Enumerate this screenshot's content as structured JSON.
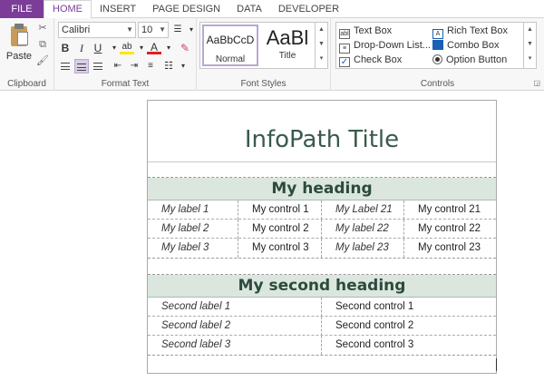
{
  "tabs": [
    {
      "label": "FILE"
    },
    {
      "label": "HOME"
    },
    {
      "label": "INSERT"
    },
    {
      "label": "PAGE DESIGN"
    },
    {
      "label": "DATA"
    },
    {
      "label": "DEVELOPER"
    }
  ],
  "active_tab": "HOME",
  "ribbon": {
    "clipboard": {
      "label": "Clipboard",
      "paste_label": "Paste"
    },
    "format_text": {
      "label": "Format Text",
      "font_name": "Calibri",
      "font_size": "10",
      "bold": "B",
      "italic": "I",
      "underline": "U",
      "highlight": "ab",
      "font_color": "A"
    },
    "font_styles": {
      "label": "Font Styles",
      "styles": [
        {
          "sample": "AaBbCcD",
          "name": "Normal"
        },
        {
          "sample": "AaBl",
          "name": "Title"
        }
      ]
    },
    "controls": {
      "label": "Controls",
      "items": [
        {
          "label": "Text Box",
          "icon": "text-box-icon"
        },
        {
          "label": "Rich Text Box",
          "icon": "rich-text-box-icon"
        },
        {
          "label": "Drop-Down List...",
          "icon": "drop-down-list-icon"
        },
        {
          "label": "Combo Box",
          "icon": "combo-box-icon"
        },
        {
          "label": "Check Box",
          "icon": "check-box-icon"
        },
        {
          "label": "Option Button",
          "icon": "option-button-icon"
        }
      ]
    }
  },
  "form": {
    "title": "InfoPath Title",
    "section1": {
      "heading": "My heading",
      "rows": [
        [
          "My label 1",
          "My control 1",
          "My Label 21",
          "My control 21"
        ],
        [
          "My label 2",
          "My control 2",
          "My label 22",
          "My control 22"
        ],
        [
          "My label 3",
          "My control 3",
          "My label 23",
          "My control 23"
        ]
      ]
    },
    "section2": {
      "heading": "My second heading",
      "rows": [
        [
          "Second label 1",
          "Second control 1"
        ],
        [
          "Second label 2",
          "Second control 2"
        ],
        [
          "Second label 3",
          "Second control 3"
        ]
      ]
    }
  },
  "colors": {
    "file_tab": "#7b3d97",
    "heading_bg": "#dbe7de",
    "title_text": "#3a5a4c"
  }
}
